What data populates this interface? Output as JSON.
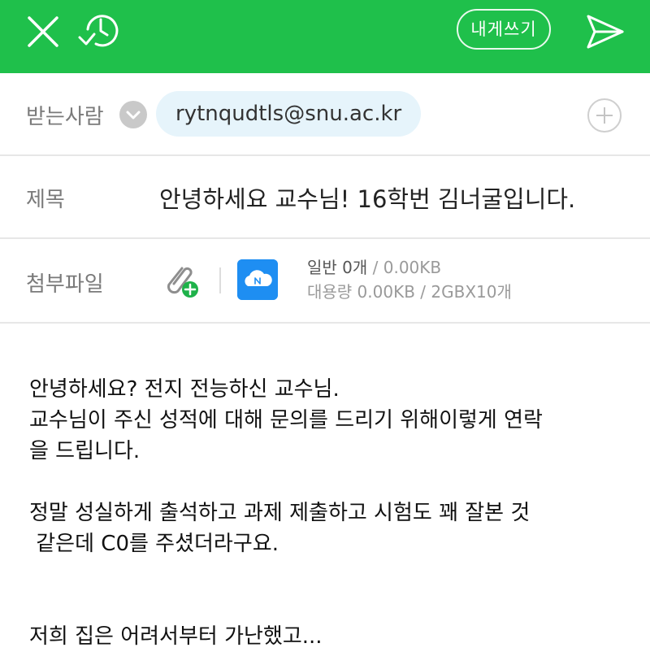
{
  "toolbar": {
    "close_icon": "close-icon",
    "schedule_icon": "scheduled-send-icon",
    "self_button_label": "내게쓰기",
    "send_icon": "send-icon",
    "background_color": "#1fc04b"
  },
  "recipient": {
    "label": "받는사람",
    "dropdown_icon": "chevron-down-icon",
    "address": "rytnqudtls@snu.ac.kr",
    "add_icon": "plus-icon"
  },
  "subject": {
    "label": "제목",
    "value": "안녕하세요 교수님! 16학번 김너굴입니다."
  },
  "attachment": {
    "label": "첨부파일",
    "attach_icon": "paperclip-add-icon",
    "cloud_icon": "naver-mybox-icon",
    "general_label": "일반 0개",
    "general_size": " / 0.00KB",
    "large_label": "대용량 0.00KB / 2GBX10개"
  },
  "body": {
    "lines": [
      "안녕하세요? 전지 전능하신 교수님.",
      "교수님이 주신 성적에 대해 문의를 드리기 위해이렇게 연락",
      "을 드립니다.",
      "",
      "정말 성실하게 출석하고 과제 제출하고 시험도 꽤 잘본 것",
      " 같은데 C0를 주셨더라구요.",
      "",
      "",
      "저희 집은 어려서부터 가난했고..."
    ]
  }
}
